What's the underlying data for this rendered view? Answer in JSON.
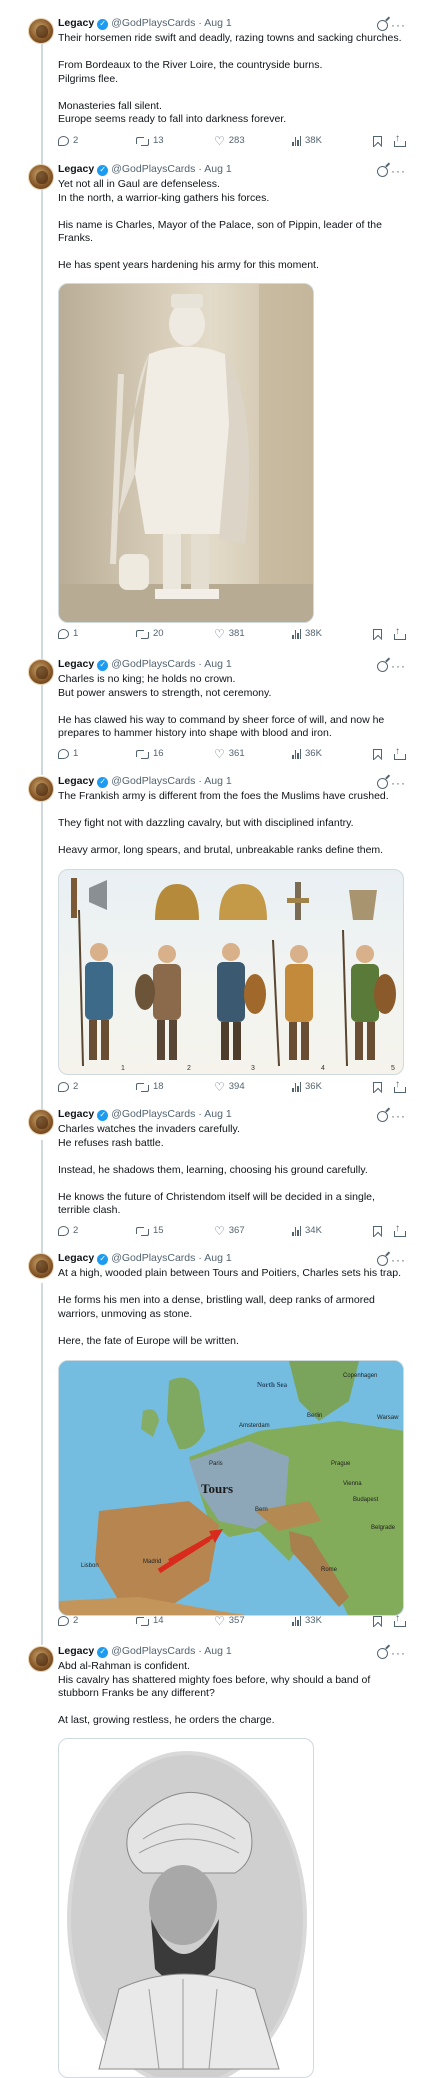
{
  "account": {
    "name": "Legacy",
    "handle": "@GodPlaysCards",
    "date": "· Aug 1"
  },
  "tweets": [
    {
      "paragraphs": [
        [
          "Their horsemen ride swift and deadly, razing towns and sacking churches."
        ],
        [
          "From Bordeaux to the River Loire, the countryside burns.",
          "Pilgrims flee."
        ],
        [
          "Monasteries fall silent.",
          "Europe seems ready to fall into darkness forever."
        ]
      ],
      "stats": {
        "replies": "2",
        "reposts": "13",
        "likes": "283",
        "views": "38K"
      }
    },
    {
      "paragraphs": [
        [
          "Yet not all in Gaul are defenseless.",
          "In the north, a warrior-king gathers his forces."
        ],
        [
          "His name is Charles, Mayor of the Palace, son of Pippin, leader of the Franks."
        ],
        [
          "He has spent years hardening his army for this moment."
        ]
      ],
      "stats": {
        "replies": "1",
        "reposts": "20",
        "likes": "381",
        "views": "38K"
      }
    },
    {
      "paragraphs": [
        [
          "Charles is no king; he holds no crown.",
          "But power answers to strength, not ceremony."
        ],
        [
          "He has clawed his way to command by sheer force of will, and now he prepares to hammer history into shape with blood and iron."
        ]
      ],
      "stats": {
        "replies": "1",
        "reposts": "16",
        "likes": "361",
        "views": "36K"
      }
    },
    {
      "paragraphs": [
        [
          "The Frankish army is different from the foes the Muslims have crushed."
        ],
        [
          "They fight not with dazzling cavalry, but with disciplined infantry."
        ],
        [
          "Heavy armor, long spears, and brutal, unbreakable ranks define them."
        ]
      ],
      "stats": {
        "replies": "2",
        "reposts": "18",
        "likes": "394",
        "views": "36K"
      }
    },
    {
      "paragraphs": [
        [
          "Charles watches the invaders carefully.",
          "He refuses rash battle."
        ],
        [
          "Instead, he shadows them, learning, choosing his ground carefully."
        ],
        [
          "He knows the future of Christendom itself will be decided in a single, terrible clash."
        ]
      ],
      "stats": {
        "replies": "2",
        "reposts": "15",
        "likes": "367",
        "views": "34K"
      }
    },
    {
      "paragraphs": [
        [
          "At a high, wooded plain between Tours and Poitiers, Charles sets his trap."
        ],
        [
          "He forms his men into a dense, bristling wall, deep ranks of armored warriors, unmoving as stone."
        ],
        [
          "Here, the fate of Europe will be written."
        ]
      ],
      "stats": {
        "replies": "2",
        "reposts": "14",
        "likes": "357",
        "views": "33K"
      }
    },
    {
      "paragraphs": [
        [
          "Abd al-Rahman is confident.",
          "His cavalry has shattered mighty foes before, why should a band of stubborn Franks be any different?"
        ],
        [
          "At last, growing restless, he orders the charge."
        ]
      ]
    }
  ],
  "map_labels": {
    "tours": "Tours",
    "north_sea": "North Sea",
    "cities": [
      "Amsterdam",
      "Paris",
      "Berlin",
      "Warsaw",
      "Prague",
      "Vienna",
      "Bern",
      "Budapest",
      "Belgrade",
      "Rome",
      "Madrid",
      "Lisbon",
      "Copenhagen"
    ]
  },
  "figure_numbers": [
    "1",
    "2",
    "3",
    "4",
    "5"
  ]
}
